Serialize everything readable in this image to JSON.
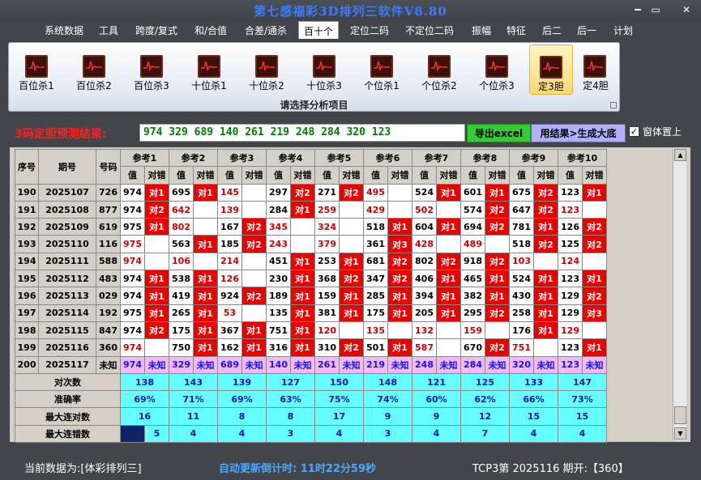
{
  "window": {
    "title": "第七感福彩3D排列三软件V8.80",
    "minimize": "━",
    "maximize": "▭",
    "close": "✕"
  },
  "menu": [
    {
      "label": "系统数据",
      "active": false
    },
    {
      "label": "工具",
      "active": false
    },
    {
      "label": "跨度/复式",
      "active": false
    },
    {
      "label": "和/合值",
      "active": false
    },
    {
      "label": "合差/通杀",
      "active": false
    },
    {
      "label": "百十个",
      "active": true
    },
    {
      "label": "定位二码",
      "active": false
    },
    {
      "label": "不定位二码",
      "active": false
    },
    {
      "label": "振幅",
      "active": false
    },
    {
      "label": "特征",
      "active": false
    },
    {
      "label": "后二",
      "active": false
    },
    {
      "label": "后一",
      "active": false
    },
    {
      "label": "计划",
      "active": false
    }
  ],
  "ribbon": {
    "caption": "请选择分析项目",
    "buttons": [
      {
        "label": "百位杀1",
        "selected": false,
        "icon": "chart-icon"
      },
      {
        "label": "百位杀2",
        "selected": false,
        "icon": "chart-icon"
      },
      {
        "label": "百位杀3",
        "selected": false,
        "icon": "chart-icon"
      },
      {
        "label": "十位杀1",
        "selected": false,
        "icon": "chart-icon"
      },
      {
        "label": "十位杀2",
        "selected": false,
        "icon": "chart-icon"
      },
      {
        "label": "十位杀3",
        "selected": false,
        "icon": "chart-icon"
      },
      {
        "label": "个位杀1",
        "selected": false,
        "icon": "chart-icon"
      },
      {
        "label": "个位杀2",
        "selected": false,
        "icon": "chart-icon"
      },
      {
        "label": "个位杀3",
        "selected": false,
        "icon": "chart-icon"
      },
      {
        "label": "定3胆",
        "selected": true,
        "icon": "chart-icon"
      },
      {
        "label": "定4胆",
        "selected": false,
        "icon": "chart-icon"
      }
    ]
  },
  "prediction": {
    "label": "3码定胆预测结果:",
    "value": "974 329 689 140 261 219 248 284 320 123",
    "excel_button": "导出excel",
    "bigbase_button": "用结果>生成大底",
    "ontop_checked": "✓",
    "ontop_label": "窗体置上"
  },
  "table": {
    "headers": {
      "seq": "序号",
      "period": "期号",
      "number": "号码",
      "value": "值",
      "check": "对错"
    },
    "refs": [
      "参考1",
      "参考2",
      "参考3",
      "参考4",
      "参考5",
      "参考6",
      "参考7",
      "参考8",
      "参考9",
      "参考10"
    ],
    "rows": [
      {
        "seq": "190",
        "period": "2025107",
        "number": "726",
        "cells": [
          [
            "974",
            "对1"
          ],
          [
            "695",
            "对1"
          ],
          [
            "145",
            ""
          ],
          [
            "297",
            "对2"
          ],
          [
            "271",
            "对2"
          ],
          [
            "495",
            ""
          ],
          [
            "524",
            "对1"
          ],
          [
            "601",
            "对1"
          ],
          [
            "675",
            "对2"
          ],
          [
            "123",
            "对1"
          ]
        ]
      },
      {
        "seq": "191",
        "period": "2025108",
        "number": "877",
        "cells": [
          [
            "974",
            "对2"
          ],
          [
            "642",
            ""
          ],
          [
            "139",
            ""
          ],
          [
            "284",
            "对1"
          ],
          [
            "259",
            ""
          ],
          [
            "429",
            ""
          ],
          [
            "502",
            ""
          ],
          [
            "574",
            "对2"
          ],
          [
            "647",
            "对2"
          ],
          [
            "123",
            ""
          ]
        ]
      },
      {
        "seq": "192",
        "period": "2025109",
        "number": "619",
        "cells": [
          [
            "975",
            "对1"
          ],
          [
            "802",
            ""
          ],
          [
            "167",
            "对2"
          ],
          [
            "345",
            ""
          ],
          [
            "324",
            ""
          ],
          [
            "518",
            "对1"
          ],
          [
            "604",
            "对1"
          ],
          [
            "694",
            "对2"
          ],
          [
            "781",
            "对1"
          ],
          [
            "126",
            "对2"
          ]
        ]
      },
      {
        "seq": "193",
        "period": "2025110",
        "number": "116",
        "cells": [
          [
            "975",
            ""
          ],
          [
            "563",
            "对1"
          ],
          [
            "185",
            "对2"
          ],
          [
            "243",
            ""
          ],
          [
            "379",
            ""
          ],
          [
            "361",
            "对3"
          ],
          [
            "428",
            ""
          ],
          [
            "489",
            ""
          ],
          [
            "518",
            "对2"
          ],
          [
            "125",
            "对2"
          ]
        ]
      },
      {
        "seq": "194",
        "period": "2025111",
        "number": "588",
        "cells": [
          [
            "974",
            ""
          ],
          [
            "106",
            ""
          ],
          [
            "214",
            ""
          ],
          [
            "451",
            "对1"
          ],
          [
            "253",
            "对1"
          ],
          [
            "681",
            "对2"
          ],
          [
            "802",
            "对2"
          ],
          [
            "918",
            "对2"
          ],
          [
            "103",
            ""
          ],
          [
            "124",
            ""
          ]
        ]
      },
      {
        "seq": "195",
        "period": "2025112",
        "number": "483",
        "cells": [
          [
            "974",
            "对1"
          ],
          [
            "538",
            "对1"
          ],
          [
            "126",
            ""
          ],
          [
            "230",
            "对1"
          ],
          [
            "368",
            "对2"
          ],
          [
            "347",
            "对2"
          ],
          [
            "406",
            "对1"
          ],
          [
            "465",
            "对1"
          ],
          [
            "524",
            "对1"
          ],
          [
            "123",
            "对1"
          ]
        ]
      },
      {
        "seq": "196",
        "period": "2025113",
        "number": "029",
        "cells": [
          [
            "974",
            "对1"
          ],
          [
            "419",
            "对1"
          ],
          [
            "924",
            "对2"
          ],
          [
            "189",
            "对1"
          ],
          [
            "159",
            "对1"
          ],
          [
            "285",
            "对1"
          ],
          [
            "394",
            "对1"
          ],
          [
            "382",
            "对1"
          ],
          [
            "430",
            "对1"
          ],
          [
            "129",
            "对2"
          ]
        ]
      },
      {
        "seq": "197",
        "period": "2025114",
        "number": "192",
        "cells": [
          [
            "975",
            "对1"
          ],
          [
            "265",
            "对1"
          ],
          [
            "53",
            ""
          ],
          [
            "135",
            "对1"
          ],
          [
            "381",
            "对1"
          ],
          [
            "175",
            "对1"
          ],
          [
            "205",
            "对1"
          ],
          [
            "295",
            "对2"
          ],
          [
            "258",
            "对1"
          ],
          [
            "129",
            "对3"
          ]
        ]
      },
      {
        "seq": "198",
        "period": "2025115",
        "number": "847",
        "cells": [
          [
            "974",
            "对2"
          ],
          [
            "175",
            "对1"
          ],
          [
            "367",
            "对1"
          ],
          [
            "751",
            "对1"
          ],
          [
            "120",
            ""
          ],
          [
            "135",
            ""
          ],
          [
            "132",
            ""
          ],
          [
            "159",
            ""
          ],
          [
            "176",
            "对1"
          ],
          [
            "129",
            ""
          ]
        ]
      },
      {
        "seq": "199",
        "period": "2025116",
        "number": "360",
        "cells": [
          [
            "974",
            ""
          ],
          [
            "750",
            "对1"
          ],
          [
            "162",
            "对1"
          ],
          [
            "316",
            "对1"
          ],
          [
            "310",
            "对2"
          ],
          [
            "501",
            "对1"
          ],
          [
            "587",
            ""
          ],
          [
            "670",
            "对2"
          ],
          [
            "751",
            ""
          ],
          [
            "123",
            "对1"
          ]
        ]
      }
    ],
    "last_row": {
      "seq": "200",
      "period": "2025117",
      "number": "未知",
      "cells": [
        [
          "974",
          "未知"
        ],
        [
          "329",
          "未知"
        ],
        [
          "689",
          "未知"
        ],
        [
          "140",
          "未知"
        ],
        [
          "261",
          "未知"
        ],
        [
          "219",
          "未知"
        ],
        [
          "248",
          "未知"
        ],
        [
          "284",
          "未知"
        ],
        [
          "320",
          "未知"
        ],
        [
          "123",
          "未知"
        ]
      ]
    },
    "stats": [
      {
        "label": "对次数",
        "values": [
          "138",
          "143",
          "139",
          "127",
          "150",
          "148",
          "121",
          "125",
          "133",
          "147"
        ]
      },
      {
        "label": "准确率",
        "values": [
          "69%",
          "71%",
          "69%",
          "63%",
          "75%",
          "74%",
          "60%",
          "62%",
          "66%",
          "73%"
        ]
      },
      {
        "label": "最大连对数",
        "values": [
          "16",
          "11",
          "8",
          "8",
          "17",
          "9",
          "9",
          "12",
          "15",
          "15"
        ]
      },
      {
        "label": "最大连错数",
        "values": [
          "5",
          "4",
          "4",
          "3",
          "4",
          "3",
          "4",
          "7",
          "4",
          "4"
        ]
      }
    ]
  },
  "status": {
    "data_source": "当前数据为:[体彩排列三]",
    "countdown": "自动更新倒计时:  11时22分59秒",
    "draw": "TCP3第 2025116 期开:【360】"
  },
  "colors": {
    "hit": "#ee0000",
    "miss_value": "#cc0000",
    "stats_bg": "#66ffff",
    "last_row_bg": "#f5b8f5",
    "title": "#3c7bff"
  }
}
